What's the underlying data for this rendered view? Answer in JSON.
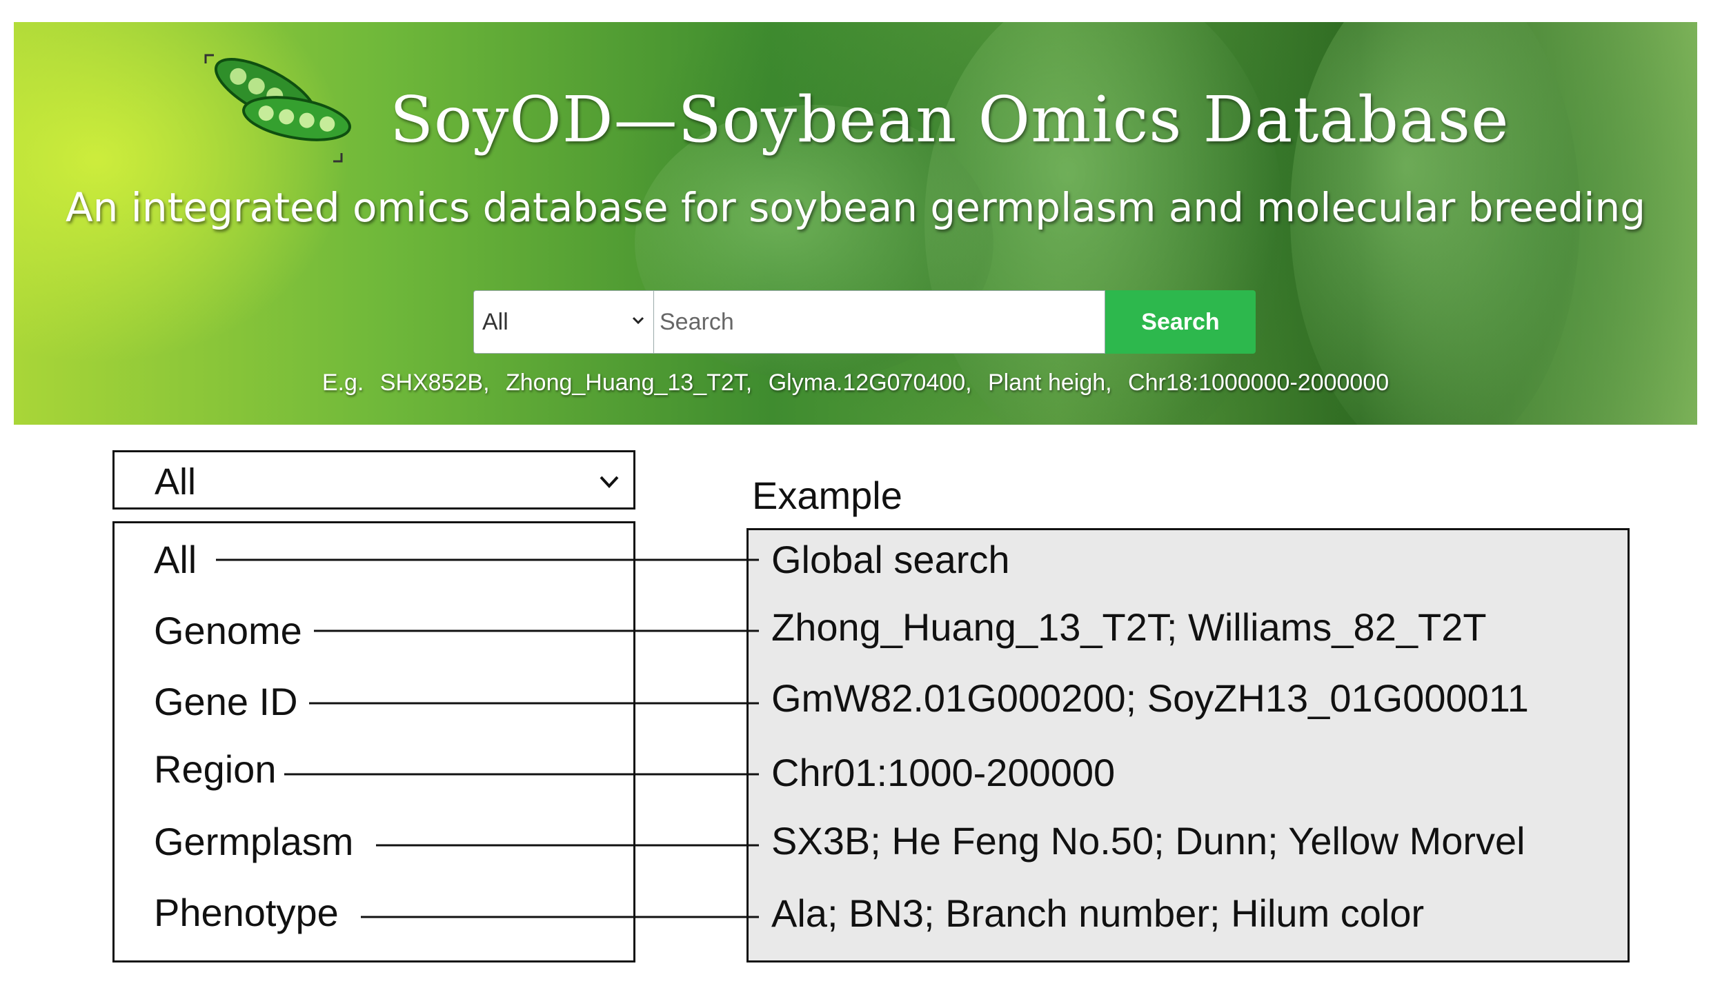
{
  "banner": {
    "title": "SoyOD—Soybean Omics Database",
    "subtitle": "An integrated omics database for soybean germplasm and molecular breeding",
    "search": {
      "category": "All",
      "placeholder": "Search",
      "button": "Search"
    },
    "examples_prefix": "E.g.",
    "examples": [
      "SHX852B,",
      "Zhong_Huang_13_T2T,",
      "Glyma.12G070400,",
      "Plant heigh,",
      "Chr18:1000000-2000000"
    ]
  },
  "diagram": {
    "dropdown_value": "All",
    "example_title": "Example",
    "options": [
      "All",
      "Genome",
      "Gene ID",
      "Region",
      "Germplasm",
      "Phenotype"
    ],
    "examples": [
      "Global search",
      "Zhong_Huang_13_T2T; Williams_82_T2T",
      "GmW82.01G000200; SoyZH13_01G000011",
      "Chr01:1000-200000",
      "SX3B; He Feng No.50; Dunn; Yellow Morvel",
      "Ala; BN3; Branch number; Hilum color"
    ]
  },
  "colors": {
    "search_button": "#2db84d",
    "examples_box": "#e9e9e9",
    "banner_green": "#3f8c2f"
  }
}
